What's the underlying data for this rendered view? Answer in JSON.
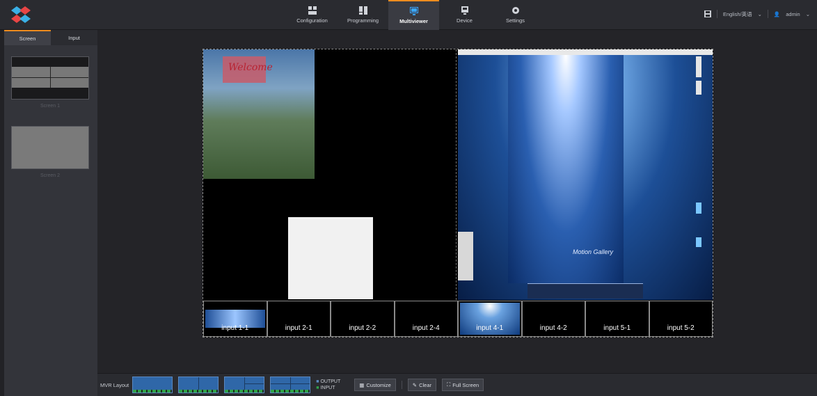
{
  "header": {
    "nav": [
      {
        "label": "Configuration",
        "icon": "configuration-icon"
      },
      {
        "label": "Programming",
        "icon": "programming-icon"
      },
      {
        "label": "Multiviewer",
        "icon": "multiviewer-icon"
      },
      {
        "label": "Device",
        "icon": "device-icon"
      },
      {
        "label": "Settings",
        "icon": "settings-icon"
      }
    ],
    "language": "English/英语",
    "user": "admin"
  },
  "sidebar": {
    "tabs": [
      "Screen",
      "Input"
    ],
    "screens": [
      {
        "label": "Screen 1"
      },
      {
        "label": "Screen 2"
      }
    ]
  },
  "canvas": {
    "window_a_text": "Welcome",
    "window_b_text": "Motion Gallery",
    "inputs": [
      "input 1-1",
      "input 2-1",
      "input 2-2",
      "input 2-4",
      "input 4-1",
      "input 4-2",
      "input 5-1",
      "input 5-2"
    ]
  },
  "footer": {
    "mvr_layout_label": "MVR Layout",
    "legend_output": "OUTPUT",
    "legend_input": "INPUT",
    "customize_label": "Customize",
    "clear_label": "Clear",
    "fullscreen_label": "Full Screen"
  },
  "colors": {
    "accent": "#f08c1e",
    "layout_blue": "#2f67a8",
    "layout_green": "#2fa34a"
  }
}
